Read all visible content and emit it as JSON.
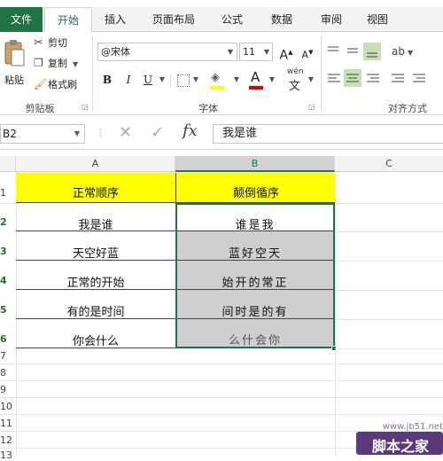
{
  "tabs": [
    "文件",
    "开始",
    "插入",
    "页面布局",
    "公式",
    "数据",
    "审阅",
    "视图"
  ],
  "clipboard": {
    "paste": "粘贴",
    "cut": "剪切",
    "copy": "复制",
    "format_painter": "格式刷",
    "group": "剪贴板"
  },
  "font": {
    "name": "@宋体",
    "size": "11",
    "grow": "A",
    "shrink": "A",
    "bold": "B",
    "italic": "I",
    "underline": "U",
    "font_color_glyph": "A",
    "pinyin": "wén",
    "group": "字体"
  },
  "alignment": {
    "group": "对齐方式"
  },
  "formula_bar": {
    "name_box": "B2",
    "fx": "fx",
    "value": "我是谁"
  },
  "columns": [
    "A",
    "B",
    "C"
  ],
  "rows": [
    "1",
    "2",
    "3",
    "4",
    "5",
    "6",
    "7",
    "8",
    "9",
    "10",
    "11",
    "12",
    "13"
  ],
  "cells": {
    "a1": "正常顺序",
    "b1": "颠倒循序",
    "col_a": [
      "我是谁",
      "天空好蓝",
      "正常的开始",
      "有的是时间",
      "你会什么"
    ],
    "col_b": [
      "谁是我",
      "蓝好空天",
      "始开的常正",
      "间时是的有",
      "么什会你"
    ]
  },
  "watermark": {
    "site": "www.jb51.net",
    "name": "脚本之家"
  },
  "colors": {
    "excel_green": "#217346",
    "header_yellow": "#ffff00",
    "selection_gray": "#d0cece"
  }
}
